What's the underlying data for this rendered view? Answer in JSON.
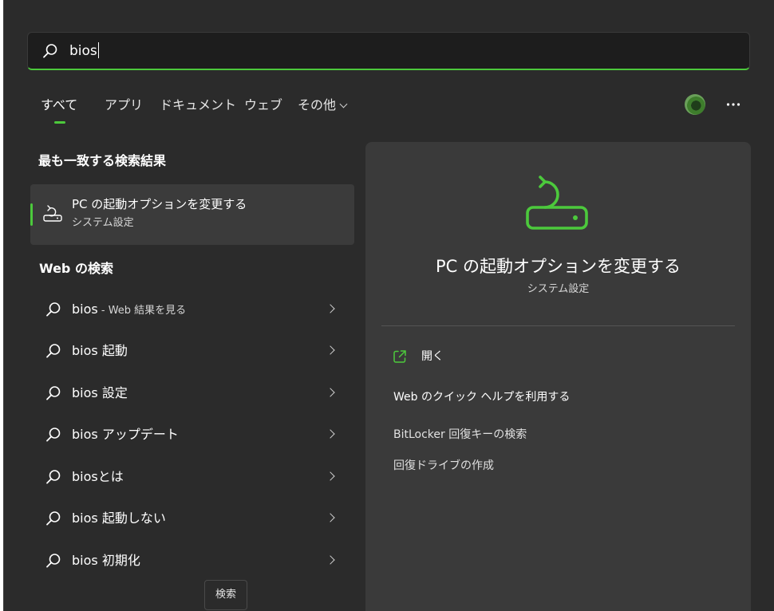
{
  "search": {
    "value": "bios",
    "icon": "search-icon"
  },
  "tabs": [
    {
      "label": "すべて",
      "active": true
    },
    {
      "label": "アプリ",
      "active": false
    },
    {
      "label": "ドキュメント",
      "active": false
    },
    {
      "label": "ウェブ",
      "active": false
    },
    {
      "label": "その他",
      "active": false
    }
  ],
  "header": {
    "avatar_icon": "avatar",
    "more_icon": "more-icon"
  },
  "best_match": {
    "section_title": "最も一致する検索結果",
    "title": "PC の起動オプションを変更する",
    "subtitle": "システム設定",
    "icon": "recovery-icon"
  },
  "web_search": {
    "section_title": "Web の検索",
    "results": [
      {
        "query": "bios",
        "suffix": " - Web 結果を見る"
      },
      {
        "query": "bios 起動",
        "suffix": ""
      },
      {
        "query": "bios 設定",
        "suffix": ""
      },
      {
        "query": "bios アップデート",
        "suffix": ""
      },
      {
        "query": "biosとは",
        "suffix": ""
      },
      {
        "query": "bios 起動しない",
        "suffix": ""
      },
      {
        "query": "bios 初期化",
        "suffix": ""
      }
    ]
  },
  "tooltip": "検索",
  "detail": {
    "title": "PC の起動オプションを変更する",
    "subtitle": "システム設定",
    "open_label": "開く",
    "help_heading": "Web のクイック ヘルプを利用する",
    "help_links": [
      "BitLocker 回復キーの検索",
      "回復ドライブの作成"
    ]
  },
  "colors": {
    "accent": "#4cc93c",
    "background": "#2b2b2b",
    "panel": "#3a3a3a"
  }
}
